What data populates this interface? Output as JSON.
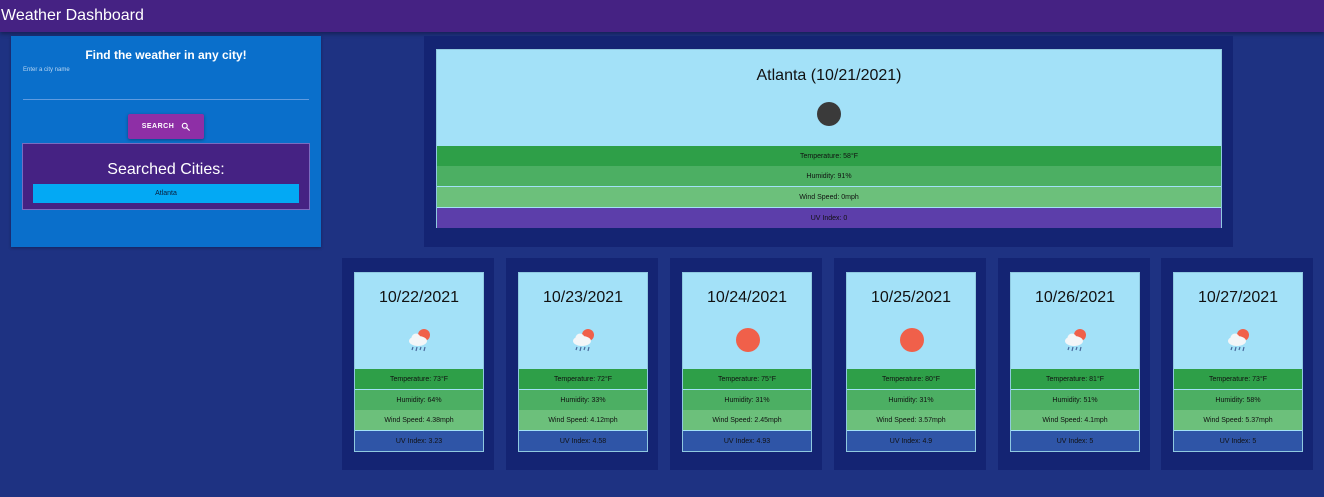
{
  "app": {
    "title": "Weather Dashboard"
  },
  "search": {
    "heading": "Find the weather in any city!",
    "label": "Enter a city name",
    "value": "",
    "button_label": "SEARCH",
    "button_icon": "search-icon"
  },
  "history": {
    "title": "Searched Cities:",
    "cities": [
      "Atlanta"
    ]
  },
  "current": {
    "title": "Atlanta (10/21/2021)",
    "icon": "moon-icon",
    "temperature": "Temperature: 58°F",
    "humidity": "Humidity: 91%",
    "wind": "Wind Speed: 0mph",
    "uv": "UV Index: 0"
  },
  "forecast": [
    {
      "date": "10/22/2021",
      "icon": "rain-sun-icon",
      "temperature": "Temperature: 73°F",
      "humidity": "Humidity: 64%",
      "wind": "Wind Speed: 4.38mph",
      "uv": "UV Index: 3.23"
    },
    {
      "date": "10/23/2021",
      "icon": "rain-sun-icon",
      "temperature": "Temperature: 72°F",
      "humidity": "Humidity: 33%",
      "wind": "Wind Speed: 4.12mph",
      "uv": "UV Index: 4.58"
    },
    {
      "date": "10/24/2021",
      "icon": "sun-icon",
      "temperature": "Temperature: 75°F",
      "humidity": "Humidity: 31%",
      "wind": "Wind Speed: 2.45mph",
      "uv": "UV Index: 4.93"
    },
    {
      "date": "10/25/2021",
      "icon": "sun-icon",
      "temperature": "Temperature: 80°F",
      "humidity": "Humidity: 31%",
      "wind": "Wind Speed: 3.57mph",
      "uv": "UV Index: 4.9"
    },
    {
      "date": "10/26/2021",
      "icon": "rain-sun-icon",
      "temperature": "Temperature: 81°F",
      "humidity": "Humidity: 51%",
      "wind": "Wind Speed: 4.1mph",
      "uv": "UV Index: 5"
    },
    {
      "date": "10/27/2021",
      "icon": "rain-sun-icon",
      "temperature": "Temperature: 73°F",
      "humidity": "Humidity: 58%",
      "wind": "Wind Speed: 5.37mph",
      "uv": "UV Index: 5"
    }
  ],
  "colors": {
    "appbar": "#452283",
    "background": "#1e3282",
    "panel": "#0a6fcb",
    "card": "#a3e1f8",
    "search_button": "#8e2fa6",
    "city_button": "#03a9f4",
    "sun": "#f0604a"
  }
}
